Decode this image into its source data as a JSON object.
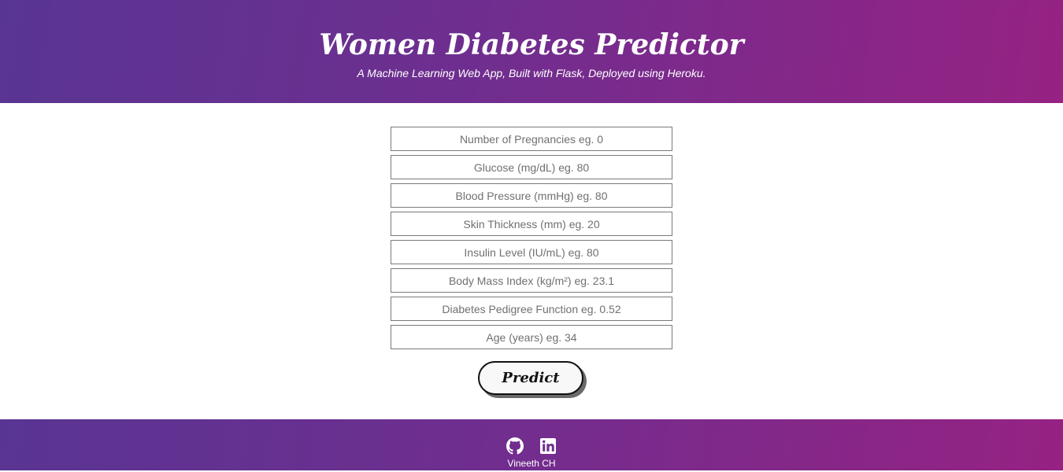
{
  "header": {
    "title": "Women Diabetes Predictor",
    "subtitle": "A Machine Learning Web App, Built with Flask, Deployed using Heroku."
  },
  "form": {
    "fields": [
      {
        "placeholder": "Number of Pregnancies eg. 0",
        "value": ""
      },
      {
        "placeholder": "Glucose (mg/dL) eg. 80",
        "value": ""
      },
      {
        "placeholder": "Blood Pressure (mmHg) eg. 80",
        "value": ""
      },
      {
        "placeholder": "Skin Thickness (mm) eg. 20",
        "value": ""
      },
      {
        "placeholder": "Insulin Level (IU/mL) eg. 80",
        "value": ""
      },
      {
        "placeholder": "Body Mass Index (kg/m²) eg. 23.1",
        "value": ""
      },
      {
        "placeholder": "Diabetes Pedigree Function eg. 0.52",
        "value": ""
      },
      {
        "placeholder": "Age (years) eg. 34",
        "value": ""
      }
    ],
    "submit_label": "Predict"
  },
  "footer": {
    "icons": [
      "github-icon",
      "linkedin-icon"
    ],
    "author": "Vineeth CH"
  },
  "colors": {
    "gradient_start": "#593593",
    "gradient_end": "#962283",
    "text_on_gradient": "#ffffff"
  }
}
